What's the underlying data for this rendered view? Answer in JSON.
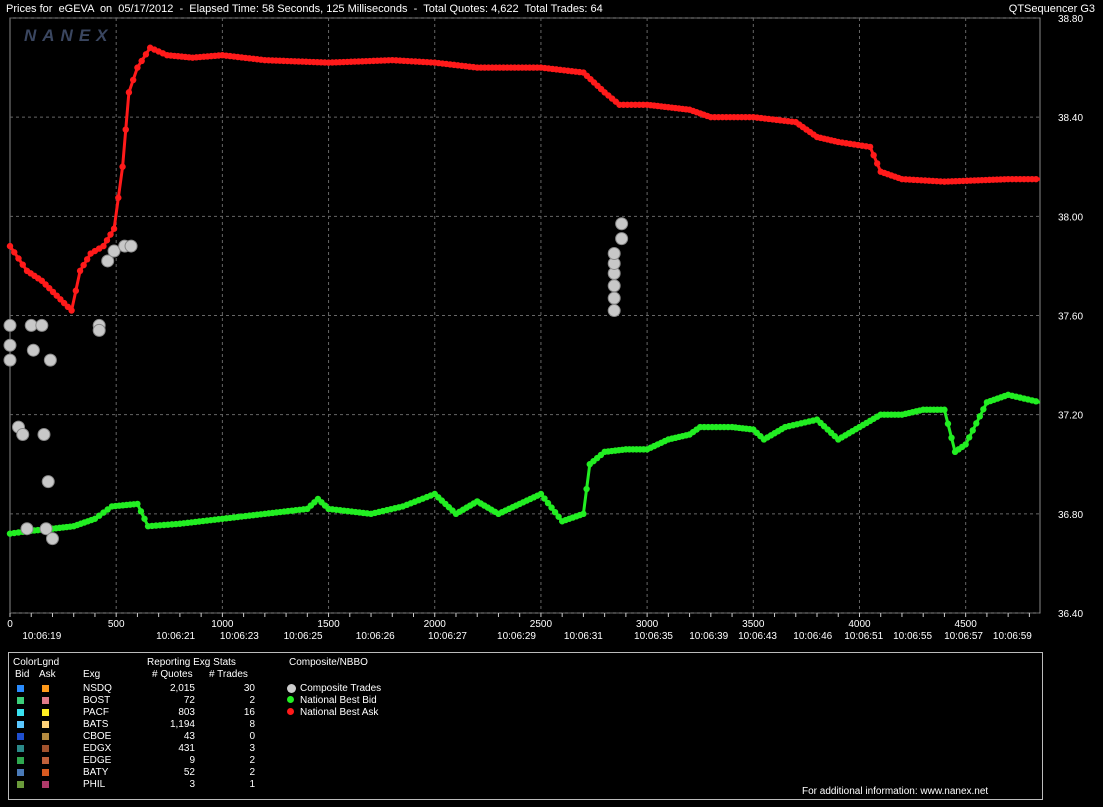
{
  "window": {
    "title_left": "Prices for  eGEVA  on  05/17/2012  -  Elapsed Time: 58 Seconds, 125 Milliseconds  -  Total Quotes: 4,622  Total Trades: 64",
    "title_right": "QTSequencer G3",
    "watermark": "NANEX"
  },
  "chart_data": {
    "type": "line",
    "title": "",
    "ylim": [
      36.4,
      38.8
    ],
    "y_ticks": [
      "38.80",
      "38.40",
      "38.00",
      "37.60",
      "37.20",
      "36.80",
      "36.40"
    ],
    "y_tick_values": [
      38.8,
      38.4,
      38.0,
      37.6,
      37.2,
      36.8,
      36.4
    ],
    "xlim": [
      0,
      4850
    ],
    "x_ticks": [
      "0",
      "500",
      "1000",
      "1500",
      "2000",
      "2500",
      "3000",
      "3500",
      "4000",
      "4500"
    ],
    "x_tick_values": [
      0,
      500,
      1000,
      1500,
      2000,
      2500,
      3000,
      3500,
      4000,
      4500
    ],
    "time_labels": [
      {
        "seq": 150,
        "label": "10:06:19"
      },
      {
        "seq": 780,
        "label": "10:06:21"
      },
      {
        "seq": 1080,
        "label": "10:06:23"
      },
      {
        "seq": 1380,
        "label": "10:06:25"
      },
      {
        "seq": 1720,
        "label": "10:06:26"
      },
      {
        "seq": 2060,
        "label": "10:06:27"
      },
      {
        "seq": 2385,
        "label": "10:06:29"
      },
      {
        "seq": 2700,
        "label": "10:06:31"
      },
      {
        "seq": 3030,
        "label": "10:06:35"
      },
      {
        "seq": 3290,
        "label": "10:06:39"
      },
      {
        "seq": 3520,
        "label": "10:06:43"
      },
      {
        "seq": 3780,
        "label": "10:06:46"
      },
      {
        "seq": 4020,
        "label": "10:06:51"
      },
      {
        "seq": 4250,
        "label": "10:06:55"
      },
      {
        "seq": 4490,
        "label": "10:06:57"
      },
      {
        "seq": 4720,
        "label": "10:06:59"
      }
    ],
    "series": [
      {
        "name": "National Best Ask",
        "color": "#ff1a1a",
        "points": [
          [
            0,
            37.88
          ],
          [
            80,
            37.78
          ],
          [
            150,
            37.74
          ],
          [
            220,
            37.68
          ],
          [
            290,
            37.62
          ],
          [
            330,
            37.78
          ],
          [
            380,
            37.85
          ],
          [
            440,
            37.88
          ],
          [
            490,
            37.95
          ],
          [
            530,
            38.2
          ],
          [
            560,
            38.5
          ],
          [
            600,
            38.6
          ],
          [
            660,
            38.68
          ],
          [
            740,
            38.65
          ],
          [
            860,
            38.64
          ],
          [
            1000,
            38.65
          ],
          [
            1200,
            38.63
          ],
          [
            1500,
            38.62
          ],
          [
            1800,
            38.63
          ],
          [
            2000,
            38.62
          ],
          [
            2200,
            38.6
          ],
          [
            2500,
            38.6
          ],
          [
            2700,
            38.58
          ],
          [
            2800,
            38.5
          ],
          [
            2870,
            38.45
          ],
          [
            3000,
            38.45
          ],
          [
            3100,
            38.44
          ],
          [
            3200,
            38.43
          ],
          [
            3300,
            38.4
          ],
          [
            3500,
            38.4
          ],
          [
            3700,
            38.38
          ],
          [
            3800,
            38.32
          ],
          [
            3900,
            38.3
          ],
          [
            4050,
            38.28
          ],
          [
            4100,
            38.18
          ],
          [
            4200,
            38.15
          ],
          [
            4400,
            38.14
          ],
          [
            4700,
            38.15
          ],
          [
            4850,
            38.15
          ]
        ]
      },
      {
        "name": "National Best Bid",
        "color": "#22ee22",
        "points": [
          [
            0,
            36.72
          ],
          [
            80,
            36.73
          ],
          [
            200,
            36.74
          ],
          [
            300,
            36.75
          ],
          [
            400,
            36.78
          ],
          [
            480,
            36.83
          ],
          [
            600,
            36.84
          ],
          [
            650,
            36.75
          ],
          [
            800,
            36.76
          ],
          [
            1000,
            36.78
          ],
          [
            1200,
            36.8
          ],
          [
            1400,
            36.82
          ],
          [
            1450,
            36.86
          ],
          [
            1500,
            36.82
          ],
          [
            1700,
            36.8
          ],
          [
            1850,
            36.83
          ],
          [
            2000,
            36.88
          ],
          [
            2100,
            36.8
          ],
          [
            2200,
            36.85
          ],
          [
            2300,
            36.8
          ],
          [
            2400,
            36.84
          ],
          [
            2500,
            36.88
          ],
          [
            2600,
            36.77
          ],
          [
            2700,
            36.8
          ],
          [
            2730,
            37.0
          ],
          [
            2800,
            37.05
          ],
          [
            2900,
            37.06
          ],
          [
            3000,
            37.06
          ],
          [
            3100,
            37.1
          ],
          [
            3200,
            37.12
          ],
          [
            3250,
            37.15
          ],
          [
            3400,
            37.15
          ],
          [
            3500,
            37.14
          ],
          [
            3550,
            37.1
          ],
          [
            3650,
            37.15
          ],
          [
            3800,
            37.18
          ],
          [
            3900,
            37.1
          ],
          [
            4000,
            37.15
          ],
          [
            4100,
            37.2
          ],
          [
            4200,
            37.2
          ],
          [
            4300,
            37.22
          ],
          [
            4400,
            37.22
          ],
          [
            4450,
            37.05
          ],
          [
            4500,
            37.08
          ],
          [
            4600,
            37.25
          ],
          [
            4700,
            37.28
          ],
          [
            4850,
            37.25
          ]
        ]
      }
    ],
    "composite_trades": [
      [
        0,
        37.56
      ],
      [
        0,
        37.48
      ],
      [
        0,
        37.42
      ],
      [
        40,
        37.15
      ],
      [
        60,
        37.12
      ],
      [
        80,
        36.74
      ],
      [
        100,
        37.56
      ],
      [
        110,
        37.46
      ],
      [
        150,
        37.56
      ],
      [
        160,
        37.12
      ],
      [
        170,
        36.74
      ],
      [
        180,
        36.93
      ],
      [
        190,
        37.42
      ],
      [
        200,
        36.7
      ],
      [
        420,
        37.56
      ],
      [
        420,
        37.54
      ],
      [
        460,
        37.82
      ],
      [
        490,
        37.86
      ],
      [
        540,
        37.88
      ],
      [
        570,
        37.88
      ],
      [
        2845,
        37.62
      ],
      [
        2845,
        37.67
      ],
      [
        2845,
        37.72
      ],
      [
        2845,
        37.77
      ],
      [
        2845,
        37.81
      ],
      [
        2845,
        37.85
      ],
      [
        2880,
        37.91
      ],
      [
        2880,
        37.97
      ]
    ]
  },
  "legend": {
    "col_colorlgnd": "ColorLgnd",
    "col_bid": "Bid",
    "col_ask": "Ask",
    "col_exg": "Exg",
    "stats_title": "Reporting Exg Stats",
    "col_quotes": "# Quotes",
    "col_trades": "# Trades",
    "composite_title": "Composite/NBBO",
    "exchanges": [
      {
        "name": "NSDQ",
        "quotes": "2,015",
        "trades": "30",
        "bid_color": "#2a8cff",
        "ask_color": "#ff9a1a"
      },
      {
        "name": "BOST",
        "quotes": "72",
        "trades": "2",
        "bid_color": "#3ccf7a",
        "ask_color": "#e07a8a"
      },
      {
        "name": "PACF",
        "quotes": "803",
        "trades": "16",
        "bid_color": "#3ae2f0",
        "ask_color": "#ffee22"
      },
      {
        "name": "BATS",
        "quotes": "1,194",
        "trades": "8",
        "bid_color": "#5bc8ff",
        "ask_color": "#ffd27a"
      },
      {
        "name": "CBOE",
        "quotes": "43",
        "trades": "0",
        "bid_color": "#1f4fd0",
        "ask_color": "#b38a40"
      },
      {
        "name": "EDGX",
        "quotes": "431",
        "trades": "3",
        "bid_color": "#2b8a8a",
        "ask_color": "#a0522d"
      },
      {
        "name": "EDGE",
        "quotes": "9",
        "trades": "2",
        "bid_color": "#2fa84f",
        "ask_color": "#c0603a"
      },
      {
        "name": "BATY",
        "quotes": "52",
        "trades": "2",
        "bid_color": "#4a7ab8",
        "ask_color": "#d85a20"
      },
      {
        "name": "PHIL",
        "quotes": "3",
        "trades": "1",
        "bid_color": "#6a9a3a",
        "ask_color": "#b03a6a"
      }
    ],
    "composite_items": [
      {
        "label": "Composite Trades",
        "color": "#cccccc"
      },
      {
        "label": "National Best Bid",
        "color": "#22ee22"
      },
      {
        "label": "National Best Ask",
        "color": "#ff1a1a"
      }
    ]
  },
  "footer": {
    "note": "For additional information: www.nanex.net"
  }
}
